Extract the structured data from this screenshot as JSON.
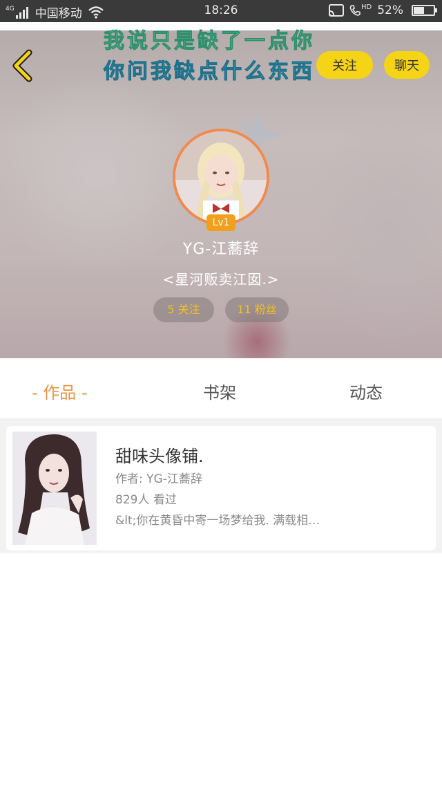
{
  "status_bar": {
    "network": "4G",
    "carrier": "中国移动",
    "time": "18:26",
    "hd_label": "HD",
    "battery_text": "52%",
    "battery_level": 0.52
  },
  "header": {
    "decor_line1": "我说只是缺了一点你",
    "decor_line2": "你问我缺点什么东西",
    "follow_label": "关注",
    "chat_label": "聊天"
  },
  "profile": {
    "level": "Lv1",
    "username": "YG-江蕎辞",
    "bio": "<星河贩卖江囡.>",
    "following": "5 关注",
    "fans": "11 粉丝"
  },
  "tabs": [
    {
      "label": "- 作品 -",
      "active": true
    },
    {
      "label": "书架",
      "active": false
    },
    {
      "label": "动态",
      "active": false
    }
  ],
  "works": [
    {
      "title": "甜味头像铺.",
      "author": "作者: YG-江蕎辞",
      "views": "829人 看过",
      "description": "&lt;你在黄昏中寄一场梦给我. 满载相…"
    }
  ],
  "colors": {
    "accent_yellow": "#f5d316",
    "avatar_ring": "#f08a4e",
    "active_tab": "#e79445",
    "stat_text": "#f3c21a"
  }
}
